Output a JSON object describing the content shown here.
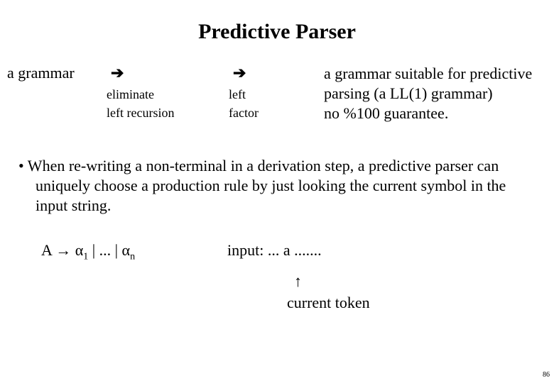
{
  "title": "Predictive Parser",
  "top": {
    "left": "a grammar",
    "arrow1": "➔",
    "step1_line1": "eliminate",
    "step1_line2": "left recursion",
    "arrow2": "➔",
    "step2_line1": "left",
    "step2_line2": "factor",
    "right_line1": "a grammar suitable for predictive",
    "right_line2": "parsing (a LL(1) grammar)",
    "right_line3": "no %100 guarantee."
  },
  "bullet": "•  When re-writing a non-terminal in a derivation step, a predictive parser can uniquely choose a production rule by just looking the current symbol in the input string.",
  "rule": {
    "lhs": "A",
    "arrow": "→",
    "alpha": "α",
    "sub1": "1",
    "mid": " | ... | ",
    "subn": "n"
  },
  "input": {
    "label": "input:  ... a .......",
    "arrow_up": "↑",
    "current": "current token"
  },
  "pagenum": "86"
}
